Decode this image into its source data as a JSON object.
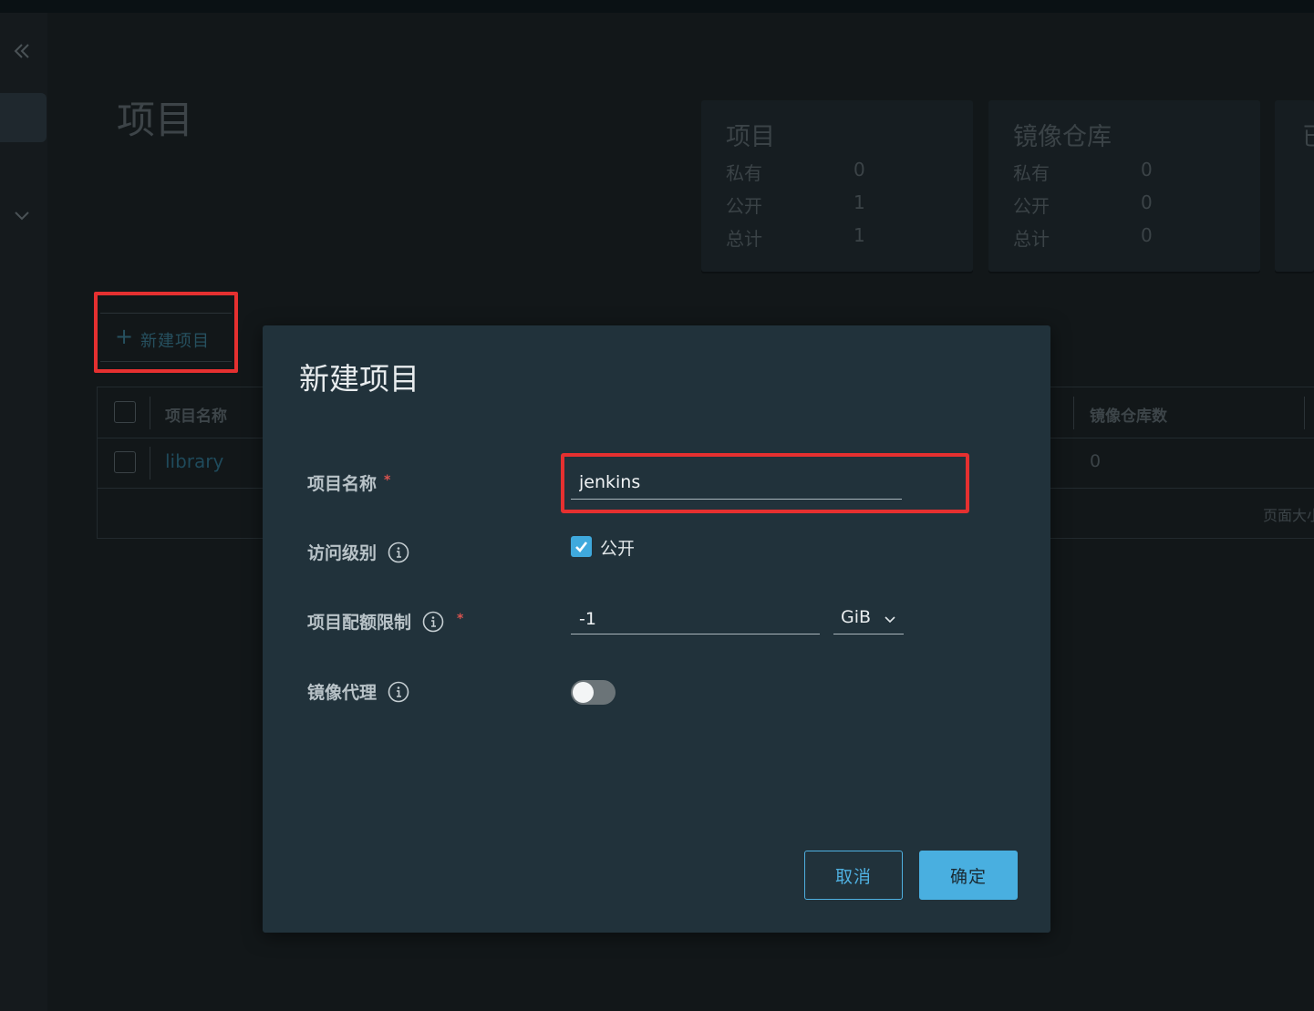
{
  "page": {
    "title": "项目"
  },
  "sidebar": {
    "collapse_icon": "double-chevron-left-icon",
    "expand_icon": "chevron-down-icon"
  },
  "stats": [
    {
      "title": "项目",
      "rows": [
        {
          "label": "私有",
          "value": "0"
        },
        {
          "label": "公开",
          "value": "1"
        },
        {
          "label": "总计",
          "value": "1"
        }
      ]
    },
    {
      "title": "镜像仓库",
      "rows": [
        {
          "label": "私有",
          "value": "0"
        },
        {
          "label": "公开",
          "value": "0"
        },
        {
          "label": "总计",
          "value": "0"
        }
      ]
    },
    {
      "title": "已"
    }
  ],
  "toolbar": {
    "new_project_label": "新建项目",
    "plus_icon": "plus-icon"
  },
  "table": {
    "columns": [
      "项目名称",
      "镜像仓库数"
    ],
    "rows": [
      {
        "name": "library",
        "repo_count": "0"
      }
    ],
    "footer": "页面大小"
  },
  "dialog": {
    "title": "新建项目",
    "fields": {
      "project_name": {
        "label": "项目名称",
        "required_mark": "*",
        "value": "jenkins"
      },
      "access_level": {
        "label": "访问级别",
        "checkbox_label": "公开",
        "checked": true
      },
      "quota": {
        "label": "项目配额限制",
        "required_mark": "*",
        "value": "-1",
        "unit": "GiB"
      },
      "proxy_cache": {
        "label": "镜像代理",
        "enabled": false
      }
    },
    "buttons": {
      "cancel": "取消",
      "ok": "确定"
    }
  },
  "colors": {
    "accent": "#49afe0",
    "annotation": "#e53030",
    "dialog_bg": "#21323b"
  }
}
